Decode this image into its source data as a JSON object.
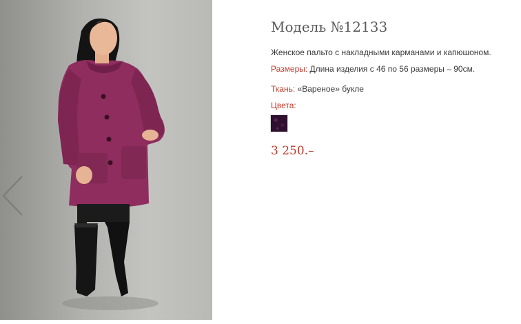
{
  "product": {
    "title": "Модель №12133",
    "description": "Женское пальто с накладными карманами и капюшоном.",
    "sizes_label": "Размеры:",
    "sizes_value": " Длина изделия с 46 по 56 размеры – 90см.",
    "fabric_label": "Ткань:",
    "fabric_value": " «Вареное» букле",
    "colors_label": "Цвета:",
    "price": "3 250.–"
  },
  "gallery": {
    "prev_icon": "chevron-left-icon"
  },
  "colors": {
    "accent": "#c0392b",
    "swatch": "#2e1030",
    "coat": "#8e2d5e"
  }
}
